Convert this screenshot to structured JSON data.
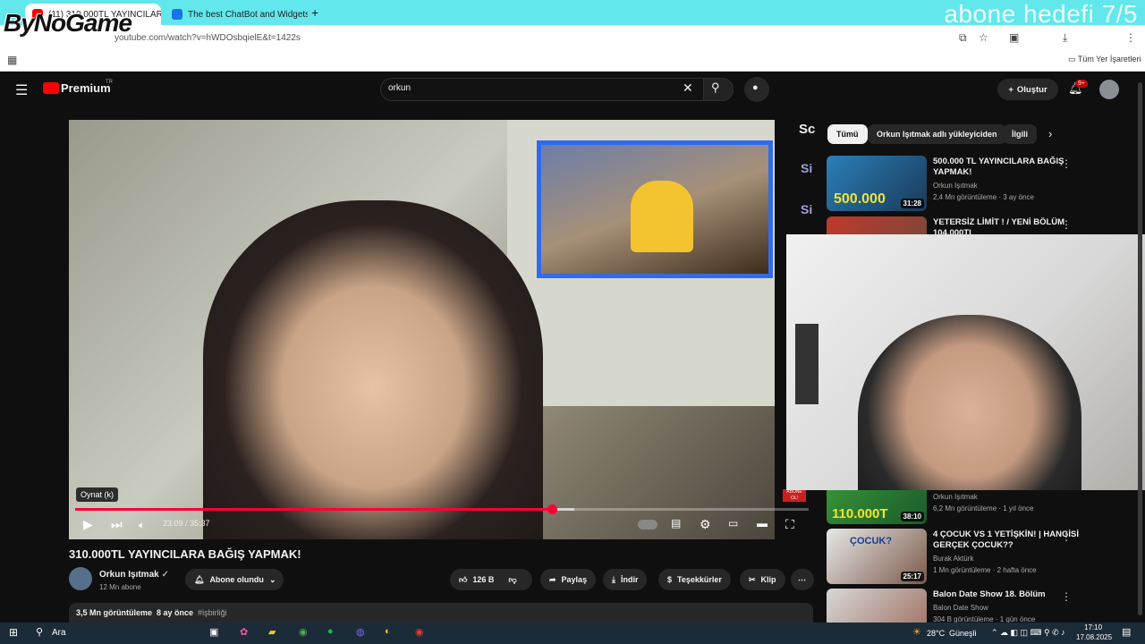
{
  "overlay": {
    "logo": "ByNoGame",
    "goal_text": "abone hedefi 7/5"
  },
  "browser": {
    "tabs": [
      {
        "label": "(11) 310.000TL YAYINCILAR"
      },
      {
        "label": "The best ChatBot and Widgets"
      }
    ],
    "url": "youtube.com/watch?v=hWDOsbqielE&t=1422s",
    "bookmarks_label": "Tüm Yer İşaretleri"
  },
  "youtube": {
    "brand": "Premium",
    "brand_region": "TR",
    "search_value": "orkun",
    "create_label": "Oluştur",
    "notif_count": "9+"
  },
  "player": {
    "tooltip": "Oynat (k)",
    "time": "23:09 / 35:37",
    "progress_fraction": 0.65,
    "buffer_fraction": 0.68,
    "stream_badge": "ABONE OL!",
    "side_letters": [
      "Sc",
      "Si",
      "Si"
    ]
  },
  "video": {
    "title": "310.000TL YAYINCILARA BAĞIŞ YAPMAK!",
    "channel": "Orkun Işıtmak",
    "subscribers": "12 Mn abone",
    "subscribed_label": "Abone olundu",
    "likes": "126 B",
    "share_label": "Paylaş",
    "download_label": "İndir",
    "thanks_label": "Teşekkürler",
    "clip_label": "Klip",
    "views": "3,5 Mn görüntüleme",
    "age": "8 ay önce",
    "hashtag": "#işbirliği"
  },
  "sidebar": {
    "chips": [
      "Tümü",
      "Orkun Işıtmak adlı yükleyiciden",
      "İlgili"
    ],
    "videos": [
      {
        "title": "500.000 TL YAYINCILARA BAĞIŞ YAPMAK!",
        "channel": "Orkun Işıtmak",
        "meta": "2,4 Mn görüntüleme · 3 ay önce",
        "duration": "31:28",
        "thumb_text": "500.000"
      },
      {
        "title": "YETERSİZ LİMİT ! / YENİ BÖLÜM 104.000TL",
        "channel": "",
        "meta": "",
        "duration": "",
        "thumb_text": ""
      },
      {
        "title": "",
        "channel": "Orkun Işıtmak",
        "meta": "6,2 Mn görüntüleme · 1 yıl önce",
        "duration": "38:10",
        "thumb_text": "110.000T"
      },
      {
        "title": "4 ÇOCUK VS 1 YETİŞKİN! | HANGİSİ GERÇEK ÇOCUK??",
        "channel": "Burak Aktürk",
        "meta": "1 Mn görüntüleme · 2 hafta önce",
        "duration": "25:17",
        "thumb_text": "ÇOCUK?"
      },
      {
        "title": "Balon Date Show 18. Bölüm",
        "channel": "Balon Date Show",
        "meta": "304 B görüntüleme · 1 gün önce",
        "duration": "",
        "thumb_text": ""
      }
    ]
  },
  "taskbar": {
    "search_label": "Ara",
    "weather": "28°C",
    "weather_desc": "Güneşli",
    "time": "17:10",
    "date": "17.08.2025"
  }
}
